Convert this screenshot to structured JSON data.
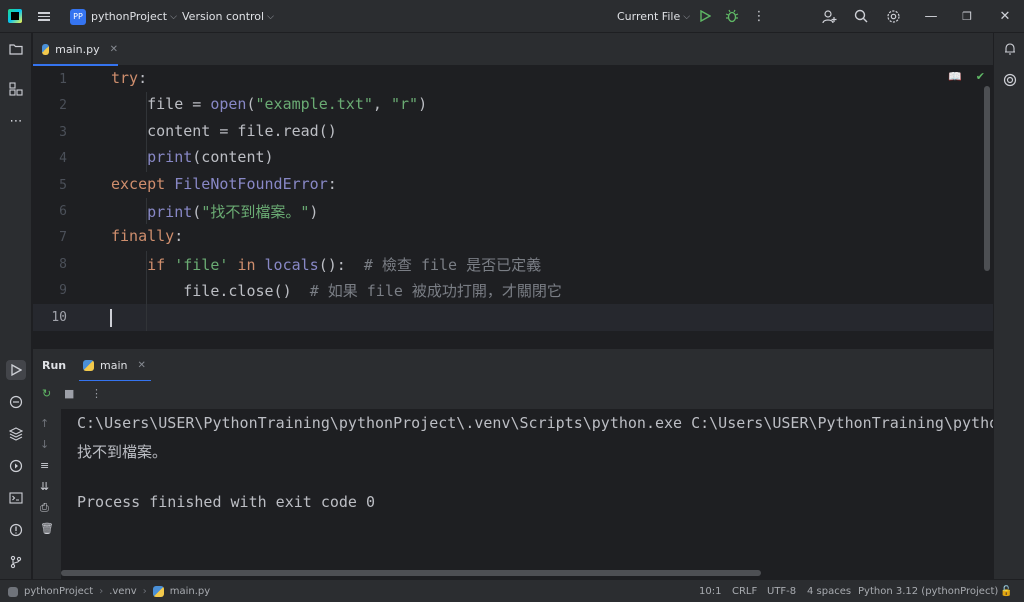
{
  "titlebar": {
    "project_badge": "PP",
    "project_name": "pythonProject",
    "vcs": "Version control",
    "run_config": "Current File"
  },
  "editor": {
    "tab": {
      "label": "main.py"
    },
    "lines": [
      {
        "no": "1"
      },
      {
        "no": "2"
      },
      {
        "no": "3"
      },
      {
        "no": "4"
      },
      {
        "no": "5"
      },
      {
        "no": "6"
      },
      {
        "no": "7"
      },
      {
        "no": "8"
      },
      {
        "no": "9"
      },
      {
        "no": "10"
      }
    ],
    "code": {
      "l1_kw": "try",
      "l1_rest": ":",
      "l2_a": "    file = ",
      "l2_fn": "open",
      "l2_b": "(",
      "l2_s1": "\"example.txt\"",
      "l2_c": ", ",
      "l2_s2": "\"r\"",
      "l2_d": ")",
      "l3": "    content = file.read()",
      "l4_a": "    ",
      "l4_fn": "print",
      "l4_b": "(content)",
      "l5_kw": "except",
      "l5_a": " ",
      "l5_ex": "FileNotFoundError",
      "l5_b": ":",
      "l6_a": "    ",
      "l6_fn": "print",
      "l6_b": "(",
      "l6_s": "\"找不到檔案。\"",
      "l6_c": ")",
      "l7_kw": "finally",
      "l7_b": ":",
      "l8_a": "    ",
      "l8_kw1": "if",
      "l8_b": " ",
      "l8_s": "'file'",
      "l8_c": " ",
      "l8_kw2": "in",
      "l8_d": " ",
      "l8_fn": "locals",
      "l8_e": "():  ",
      "l8_cmt": "# 檢查 file 是否已定義",
      "l9_a": "        file.close()  ",
      "l9_cmt": "# 如果 file 被成功打開，才關閉它"
    }
  },
  "run_panel": {
    "title": "Run",
    "tab": "main",
    "output": [
      "C:\\Users\\USER\\PythonTraining\\pythonProject\\.venv\\Scripts\\python.exe C:\\Users\\USER\\PythonTraining\\pythonProject\\main.py",
      "找不到檔案。",
      "",
      "Process finished with exit code 0"
    ]
  },
  "statusbar": {
    "crumb_project": "pythonProject",
    "crumb_venv": ".venv",
    "crumb_file": "main.py",
    "position": "10:1",
    "line_sep": "CRLF",
    "encoding": "UTF-8",
    "indent": "4 spaces",
    "interpreter": "Python 3.12 (pythonProject)"
  },
  "colors": {
    "accent": "#3574f0",
    "keyword": "#cf8e6d",
    "builtin": "#8888c6",
    "string": "#6aab73",
    "comment": "#7a7e85",
    "run_green": "#5fb865"
  }
}
